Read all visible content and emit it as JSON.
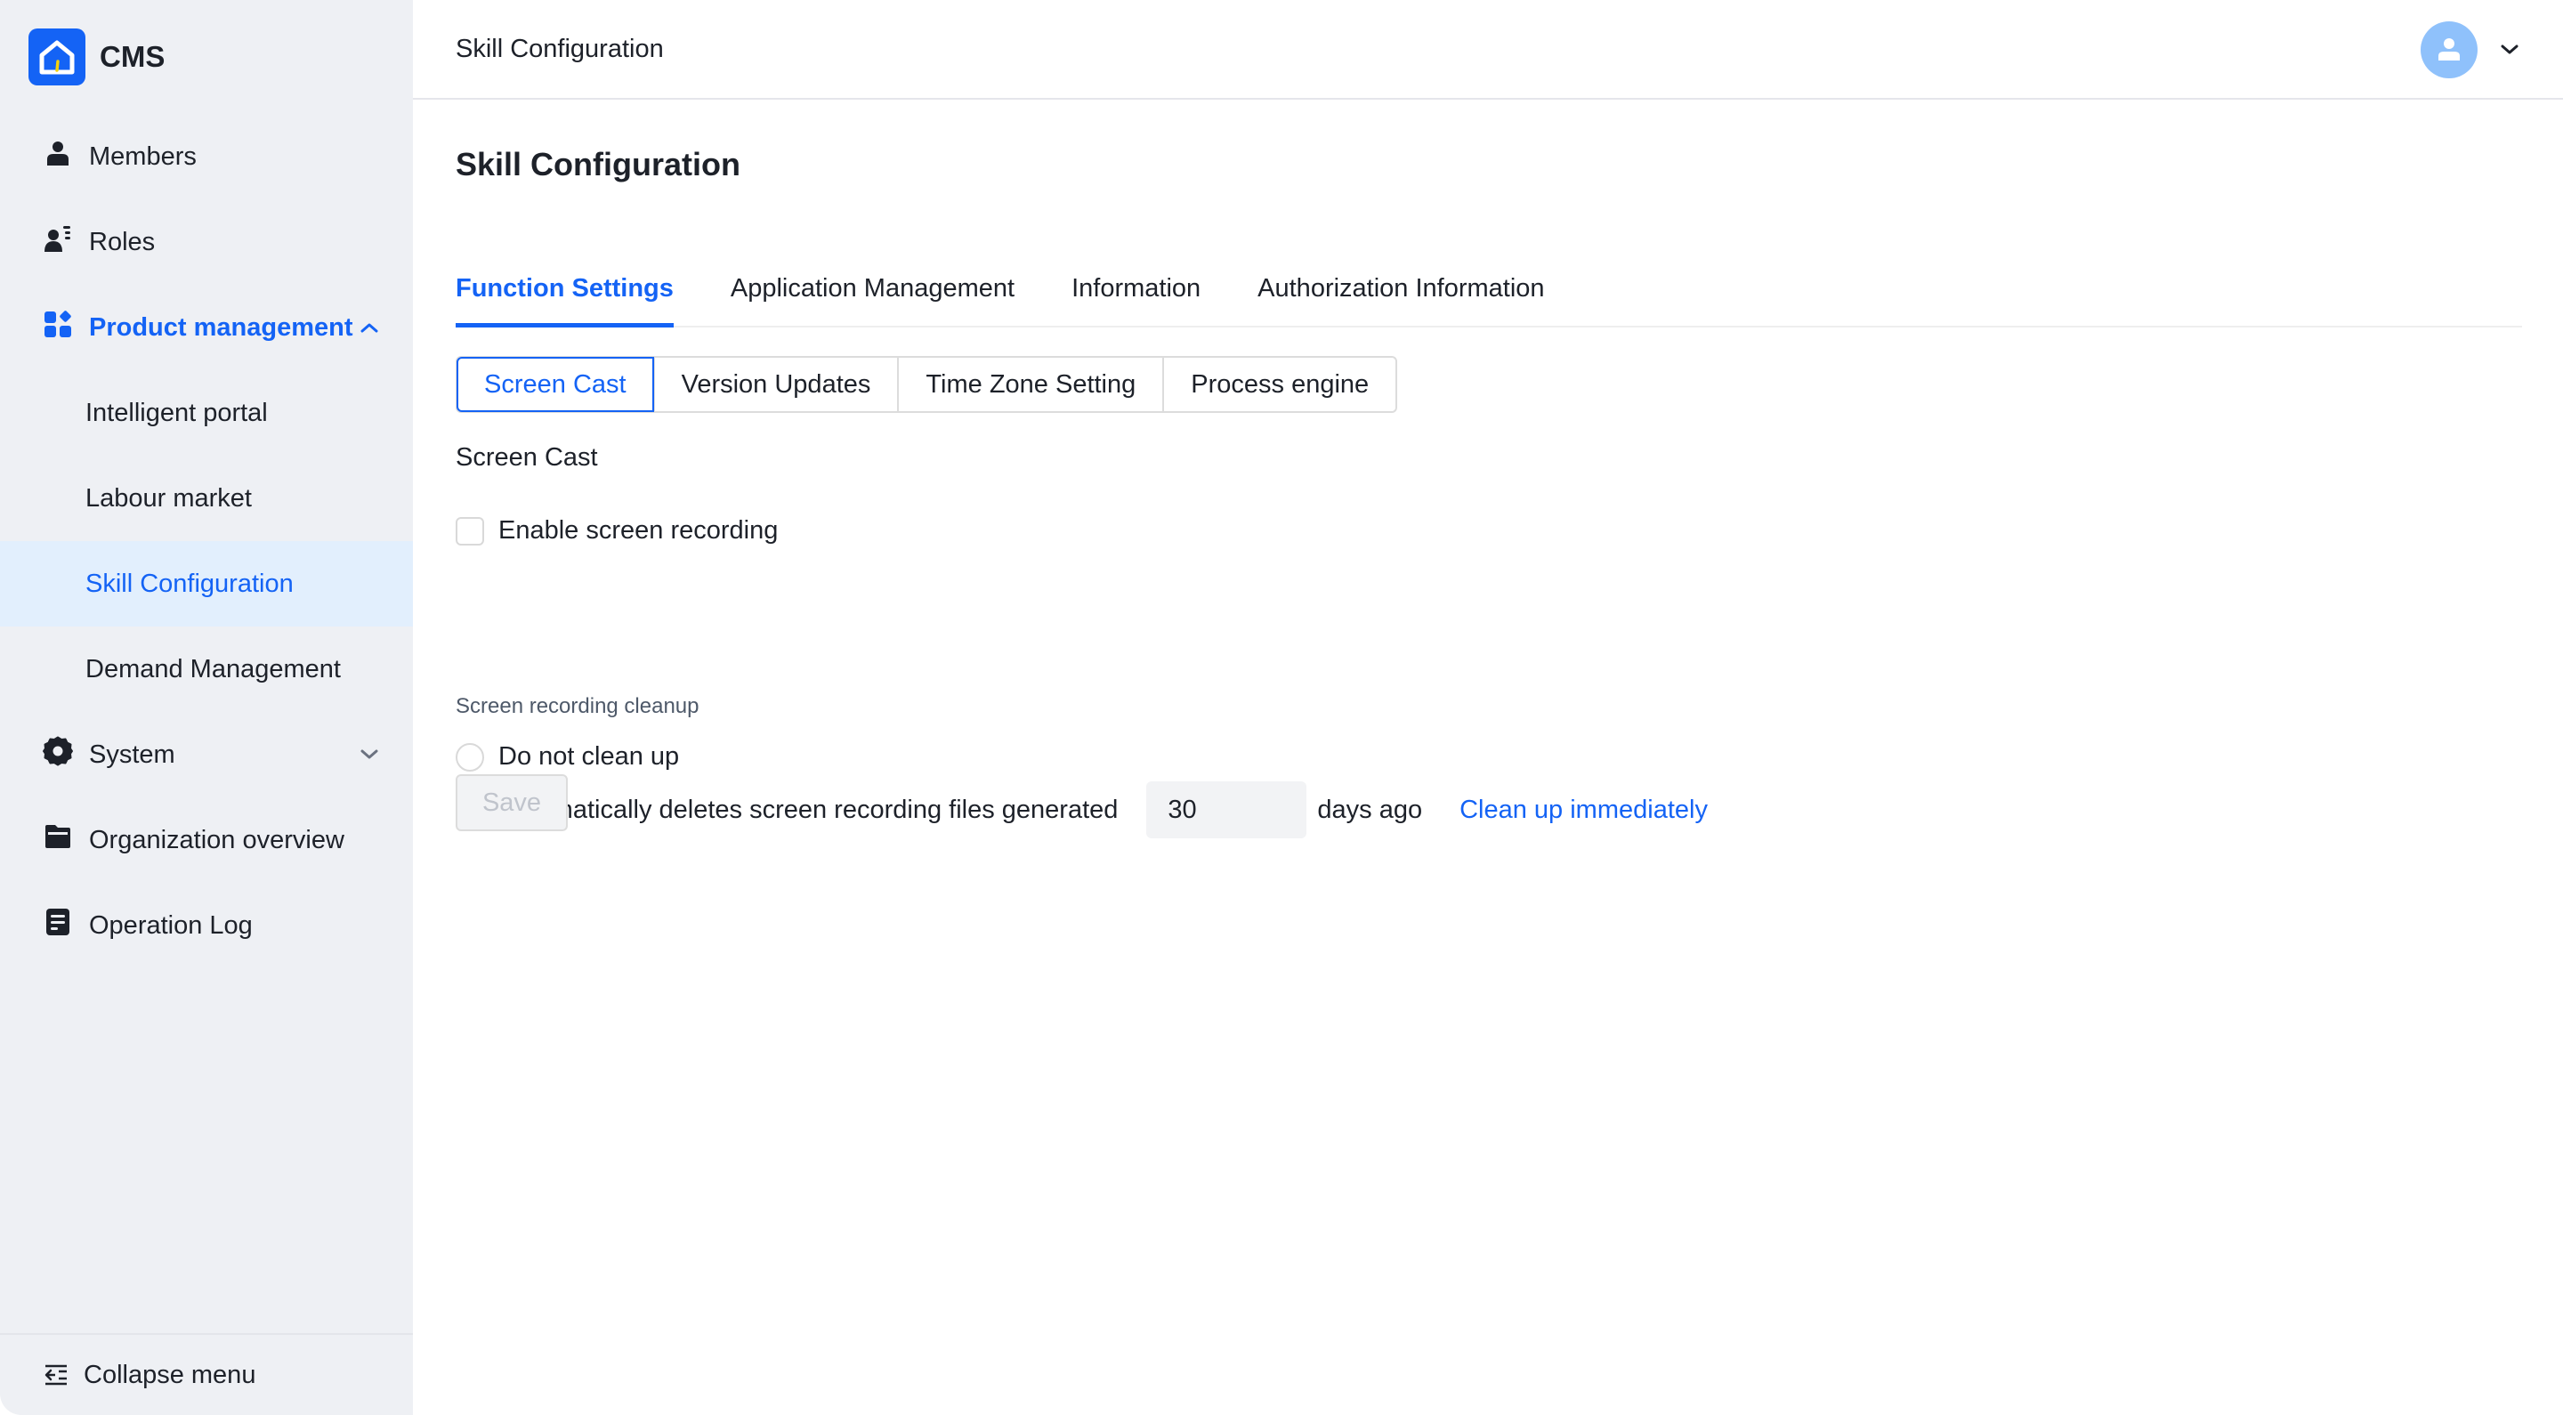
{
  "app": {
    "name": "CMS"
  },
  "sidebar": {
    "items": [
      {
        "label": "Members",
        "icon": "person-icon"
      },
      {
        "label": "Roles",
        "icon": "role-list-icon"
      },
      {
        "label": "Product management",
        "icon": "apps-grid-icon",
        "expanded": true,
        "children": [
          {
            "label": "Intelligent portal"
          },
          {
            "label": "Labour market"
          },
          {
            "label": "Skill Configuration",
            "active": true
          },
          {
            "label": "Demand Management"
          }
        ]
      },
      {
        "label": "System",
        "icon": "gear-icon",
        "expanded": false
      },
      {
        "label": "Organization overview",
        "icon": "folder-icon"
      },
      {
        "label": "Operation Log",
        "icon": "document-icon"
      }
    ],
    "collapse_label": "Collapse menu"
  },
  "header": {
    "title": "Skill Configuration",
    "avatar_icon": "user-avatar-icon"
  },
  "main": {
    "page_title": "Skill Configuration",
    "tabs": [
      {
        "label": "Function Settings",
        "active": true
      },
      {
        "label": "Application Management"
      },
      {
        "label": "Information"
      },
      {
        "label": "Authorization Information"
      }
    ],
    "segments": [
      {
        "label": "Screen Cast",
        "active": true
      },
      {
        "label": "Version Updates"
      },
      {
        "label": "Time Zone Setting"
      },
      {
        "label": "Process engine"
      }
    ],
    "section_title": "Screen Cast",
    "enable_recording": {
      "label": "Enable screen recording",
      "checked": false
    },
    "cleanup": {
      "label": "Screen recording cleanup",
      "options": [
        {
          "label": "Do not clean up",
          "checked": false
        },
        {
          "label": "Automatically deletes screen recording files generated",
          "checked": true
        }
      ],
      "days_value": "30",
      "days_suffix": "days ago",
      "clean_now_link": "Clean up immediately"
    },
    "save_label": "Save"
  },
  "colors": {
    "accent": "#1463f5",
    "sidebar_bg": "#eef0f4",
    "active_item_bg": "#e2effd",
    "avatar_bg": "#8fc1fb",
    "logo_accent": "#f5d10b"
  }
}
